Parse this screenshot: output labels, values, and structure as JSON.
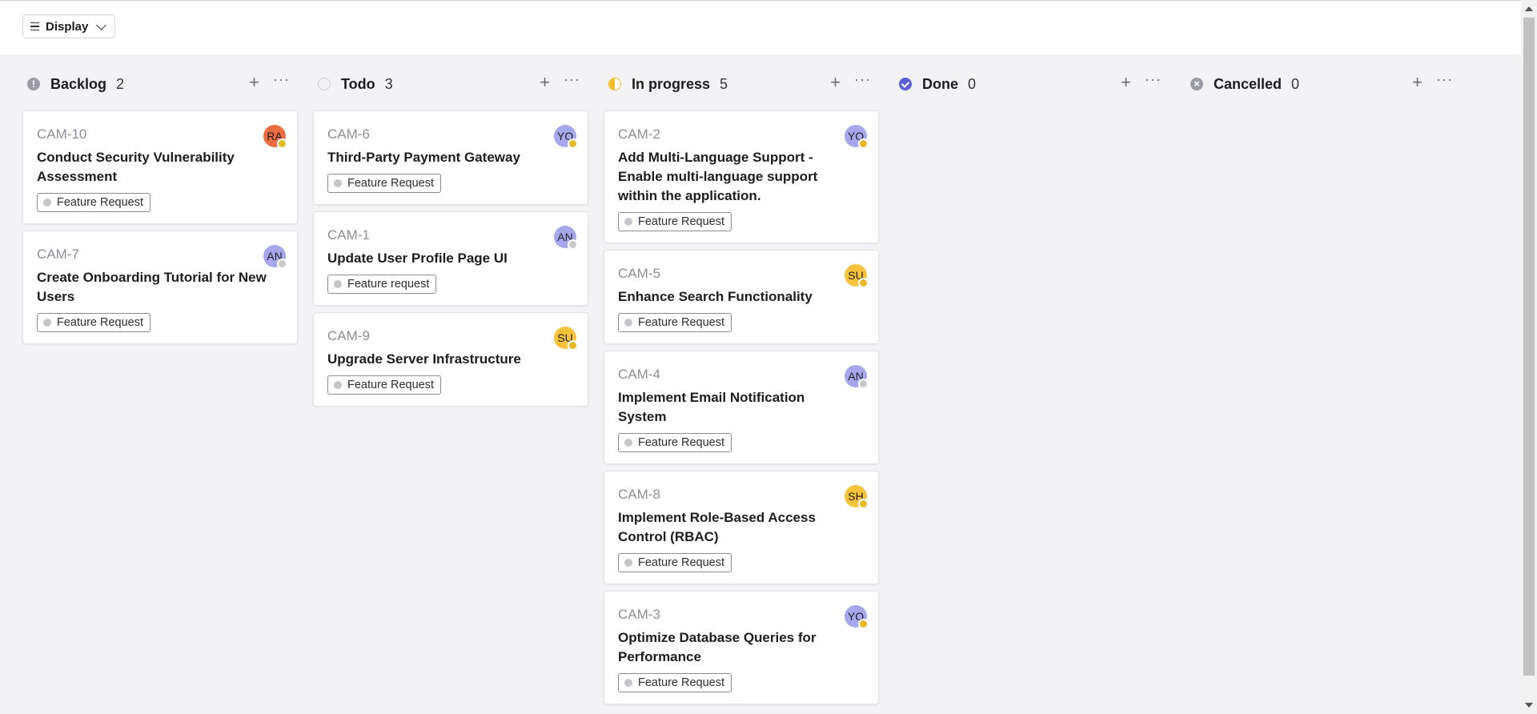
{
  "toolbar": {
    "display_label": "Display"
  },
  "colors": {
    "avatar_ra": "#ec6d3f",
    "avatar_purple": "#a7a8ec",
    "avatar_yellow": "#f6c33a",
    "status_away": "#e8b923",
    "status_offline": "#c8c8cc"
  },
  "columns": [
    {
      "title": "Backlog",
      "count": "2",
      "icon": "backlog-icon",
      "cards": [
        {
          "id": "CAM-10",
          "title": "Conduct Security Vulnerability Assessment",
          "label": "Feature Request",
          "avatar": "RA",
          "avatar_color": "#ec6d3f",
          "status": "away"
        },
        {
          "id": "CAM-7",
          "title": "Create Onboarding Tutorial for New Users",
          "label": "Feature Request",
          "avatar": "AN",
          "avatar_color": "#a7a8ec",
          "status": "offline"
        }
      ]
    },
    {
      "title": "Todo",
      "count": "3",
      "icon": "todo-icon",
      "cards": [
        {
          "id": "CAM-6",
          "title": "Third-Party Payment Gateway",
          "label": "Feature Request",
          "avatar": "YO",
          "avatar_color": "#a7a8ec",
          "status": "away"
        },
        {
          "id": "CAM-1",
          "title": "Update User Profile Page UI",
          "label": "Feature request",
          "avatar": "AN",
          "avatar_color": "#a7a8ec",
          "status": "offline"
        },
        {
          "id": "CAM-9",
          "title": "Upgrade Server Infrastructure",
          "label": "Feature Request",
          "avatar": "SU",
          "avatar_color": "#f6c33a",
          "status": "away"
        }
      ]
    },
    {
      "title": "In progress",
      "count": "5",
      "icon": "in-progress-icon",
      "cards": [
        {
          "id": "CAM-2",
          "title": "Add Multi-Language Support - Enable multi-language support within the application.",
          "label": "Feature Request",
          "avatar": "YO",
          "avatar_color": "#a7a8ec",
          "status": "away"
        },
        {
          "id": "CAM-5",
          "title": "Enhance Search Functionality",
          "label": "Feature Request",
          "avatar": "SU",
          "avatar_color": "#f6c33a",
          "status": "away"
        },
        {
          "id": "CAM-4",
          "title": "Implement Email Notification System",
          "label": "Feature Request",
          "avatar": "AN",
          "avatar_color": "#a7a8ec",
          "status": "offline"
        },
        {
          "id": "CAM-8",
          "title": "Implement Role-Based Access Control (RBAC)",
          "label": "Feature Request",
          "avatar": "SH",
          "avatar_color": "#f6c33a",
          "status": "away"
        },
        {
          "id": "CAM-3",
          "title": "Optimize Database Queries for Performance",
          "label": "Feature Request",
          "avatar": "YO",
          "avatar_color": "#a7a8ec",
          "status": "away"
        }
      ]
    },
    {
      "title": "Done",
      "count": "0",
      "icon": "done-icon",
      "cards": []
    },
    {
      "title": "Cancelled",
      "count": "0",
      "icon": "cancelled-icon",
      "cards": []
    }
  ]
}
